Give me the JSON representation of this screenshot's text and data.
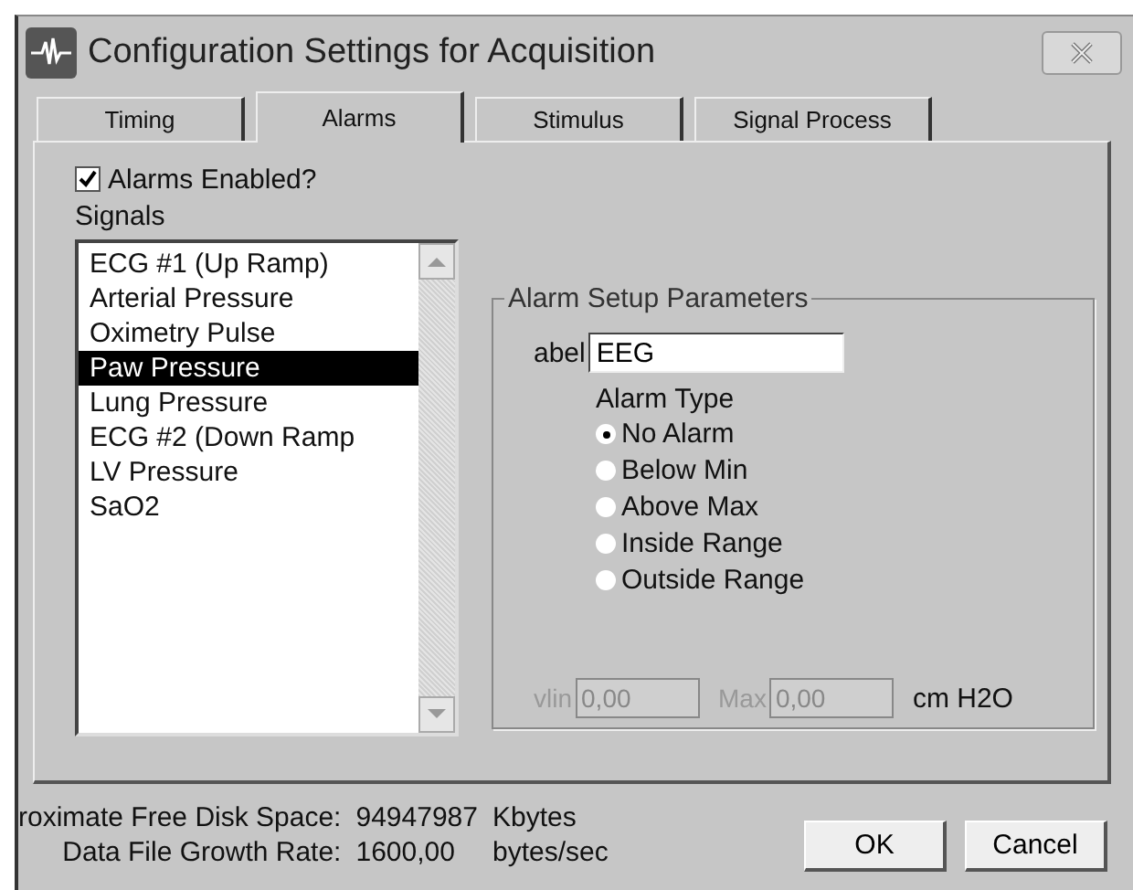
{
  "window": {
    "title": "Configuration Settings for Acquisition"
  },
  "tabs": [
    {
      "label": "Timing",
      "selected": false
    },
    {
      "label": "Alarms",
      "selected": true
    },
    {
      "label": "Stimulus",
      "selected": false
    },
    {
      "label": "Signal Process",
      "selected": false
    }
  ],
  "alarms_enabled": {
    "label": "Alarms Enabled?",
    "checked": true
  },
  "signals": {
    "label": "Signals",
    "items": [
      {
        "label": "ECG #1 (Up Ramp)",
        "selected": false
      },
      {
        "label": "Arterial Pressure",
        "selected": false
      },
      {
        "label": "Oximetry Pulse",
        "selected": false
      },
      {
        "label": "Paw Pressure",
        "selected": true
      },
      {
        "label": "Lung Pressure",
        "selected": false
      },
      {
        "label": "ECG #2 (Down Ramp",
        "selected": false
      },
      {
        "label": "LV Pressure",
        "selected": false
      },
      {
        "label": "SaO2",
        "selected": false
      }
    ]
  },
  "alarm_setup": {
    "title": "Alarm Setup Parameters",
    "label_field": {
      "label": "abel",
      "value": "EEG"
    },
    "alarm_type": {
      "label": "Alarm Type",
      "options": [
        {
          "label": "No Alarm",
          "selected": true
        },
        {
          "label": "Below Min",
          "selected": false
        },
        {
          "label": "Above Max",
          "selected": false
        },
        {
          "label": "Inside Range",
          "selected": false
        },
        {
          "label": "Outside Range",
          "selected": false
        }
      ]
    },
    "min": {
      "label": "vlin",
      "value": "0,00",
      "disabled": true
    },
    "max": {
      "label": "Max",
      "value": "0,00",
      "disabled": true
    },
    "unit": "cm H2O"
  },
  "stats": [
    {
      "label": "roximate Free Disk Space:",
      "value": "94947987",
      "unit": "Kbytes"
    },
    {
      "label": "Data File Growth Rate:",
      "value": "1600,00",
      "unit": "bytes/sec"
    }
  ],
  "buttons": [
    "OK",
    "Cancel"
  ]
}
